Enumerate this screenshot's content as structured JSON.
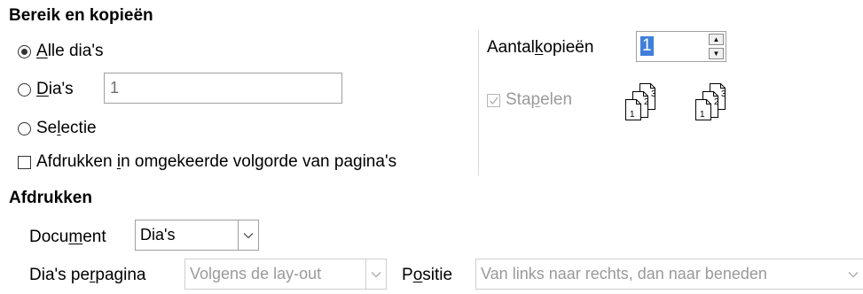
{
  "range_section": {
    "title": "Bereik en kopieën",
    "all_slides": {
      "label_u": "A",
      "label_rest": "lle dia's",
      "checked": true
    },
    "slides": {
      "label_u": "D",
      "label_rest": "ia's",
      "value": "1",
      "checked": false
    },
    "selection": {
      "label_pre": "Se",
      "label_u": "l",
      "label_rest": "ectie",
      "checked": false
    },
    "reverse": {
      "label_pre": "Afdrukken ",
      "label_u": "i",
      "label_rest": "n omgekeerde volgorde van pagina's",
      "checked": false
    }
  },
  "copies": {
    "label_pre": "Aantal ",
    "label_u": "k",
    "label_rest": "opieën",
    "value": "1",
    "collate": {
      "label_pre": "Sta",
      "label_u": "p",
      "label_rest": "elen",
      "checked": true,
      "enabled": false
    },
    "collate_icon_numbers": [
      "1",
      "2",
      "3"
    ]
  },
  "print_section": {
    "title": "Afdrukken",
    "document": {
      "label_pre": "Docu",
      "label_u": "m",
      "label_rest": "ent",
      "value": "Dia's"
    },
    "slides_per_page": {
      "label_pre": "Dia's pe",
      "label_u": "r",
      "label_rest": " pagina",
      "value": "Volgens de lay-out"
    },
    "position": {
      "label_pre": "P",
      "label_u": "o",
      "label_rest": "sitie",
      "value": "Van links naar rechts, dan naar beneden"
    }
  }
}
